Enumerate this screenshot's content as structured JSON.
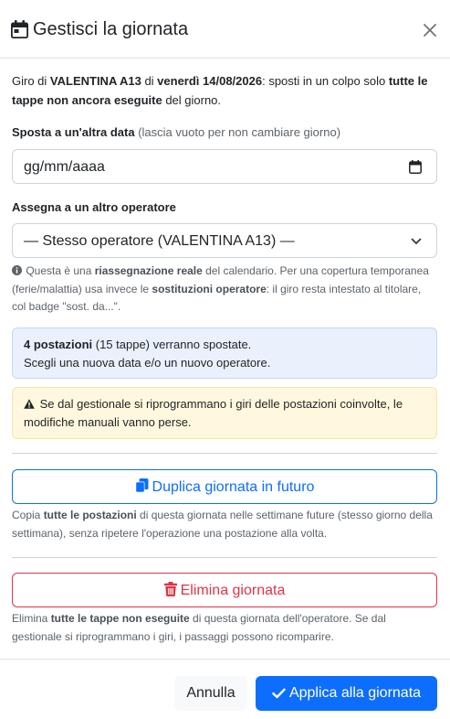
{
  "modal": {
    "title": "Gestisci la giornata",
    "title_icon": "calendar-icon",
    "close_icon": "close-icon"
  },
  "intro": {
    "p1": "Giro di ",
    "operator": "VALENTINA A13",
    "p2": " di ",
    "date": "venerdì 14/08/2026",
    "p3": ": sposti in un colpo solo ",
    "bold_target": "tutte le tappe non ancora eseguite",
    "p4": " del giorno."
  },
  "date_field": {
    "label": "Sposta a un'altra data",
    "hint": " (lascia vuoto per non cambiare giorno)",
    "value": "gg/mm/aaaa",
    "icon": "calendar-picker-icon"
  },
  "operator_field": {
    "label": "Assegna a un altro operatore",
    "value": "— Stesso operatore (VALENTINA A13) —",
    "icon": "chevron-down-icon"
  },
  "help": {
    "icon": "info-circle-icon",
    "t1": " Questa è una ",
    "b1": "riassegnazione reale",
    "t2": " del calendario. Per una copertura temporanea (ferie/malattia) usa invece le ",
    "b2": "sostituzioni operatore",
    "t3": ": il giro resta intestato al titolare, col badge \"sost. da...\"."
  },
  "info_alert": {
    "count": "4 postazioni",
    "t1": " (15 tappe) verranno spostate.",
    "line2": "Scegli una nuova data e/o un nuovo operatore."
  },
  "warn_alert": {
    "icon": "warning-triangle-icon",
    "text": " Se dal gestionale si riprogrammano i giri delle postazioni coinvolte, le modifiche manuali vanno perse."
  },
  "duplicate": {
    "label": "Duplica giornata in futuro",
    "icon": "copy-icon",
    "d1": "Copia ",
    "db": "tutte le postazioni",
    "d2": " di questa giornata nelle settimane future (stesso giorno della settimana), senza ripetere l'operazione una postazione alla volta."
  },
  "delete": {
    "label": "Elimina giornata",
    "icon": "trash-icon",
    "d1": "Elimina ",
    "db": "tutte le tappe non eseguite",
    "d2": " di questa giornata dell'operatore. Se dal gestionale si riprogrammano i giri, i passaggi possono ricomparire."
  },
  "footer": {
    "cancel": "Annulla",
    "apply": "Applica alla giornata",
    "apply_icon": "check-icon"
  },
  "colors": {
    "primary": "#0d6efd",
    "danger": "#dc3545",
    "info_bg": "#eaf1fd",
    "warn_bg": "#fff8de"
  }
}
